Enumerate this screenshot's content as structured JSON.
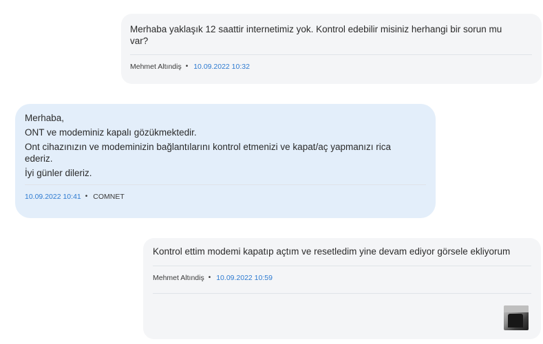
{
  "messages": [
    {
      "id": "msg1",
      "side": "right",
      "text": "Merhaba yaklaşık 12 saattir internetimiz yok. Kontrol edebilir misiniz herhangi bir sorun mu var?",
      "author": "Mehmet Altındiş",
      "separator": "•",
      "timestamp": "10.09.2022 10:32"
    },
    {
      "id": "msg2",
      "side": "left",
      "paragraphs": [
        "Merhaba,",
        "ONT ve modeminiz kapalı gözükmektedir.",
        "Ont cihazınızın ve modeminizin bağlantılarını kontrol etmenizi ve kapat/aç yapmanızı rica ederiz.",
        "İyi günler dileriz."
      ],
      "timestamp": "10.09.2022 10:41",
      "separator": "•",
      "author": "COMNET"
    },
    {
      "id": "msg3",
      "side": "right",
      "text": "Kontrol ettim modemi kapatıp açtım ve resetledim yine devam ediyor görsele ekliyorum",
      "author": "Mehmet Altındiş",
      "separator": "•",
      "timestamp": "10.09.2022 10:59",
      "attachment_icon": "image-thumbnail-icon"
    }
  ],
  "colors": {
    "user_bubble": "#f4f5f7",
    "agent_bubble": "#e3eefa",
    "timestamp": "#2e7bd1",
    "divider": "#dfe3e8"
  }
}
